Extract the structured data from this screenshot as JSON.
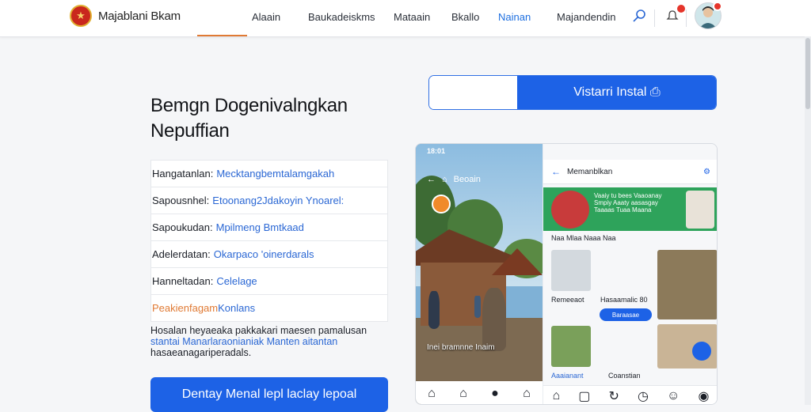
{
  "brand": {
    "name": "Majablani Bkam"
  },
  "nav": {
    "items": [
      "Alaain",
      "Baukadeiskms",
      "Mataain",
      "Bkallo",
      "Nainan",
      "Majandendin"
    ],
    "active_index": 4
  },
  "headline": [
    "Bemgn Dogenivalngkan",
    "Nepuffian"
  ],
  "install": {
    "button_label": "Vistarri Instal ⎙"
  },
  "info_rows": [
    {
      "key": "Hangatanlan:",
      "value": "Mecktangbemtalamgakah"
    },
    {
      "key": "Sapousnhel:",
      "value": "Etoonang2Jdakoyin Ynoarel:"
    },
    {
      "key": "Sapoukudan:",
      "value": "Mpilmeng Bmtkaad"
    },
    {
      "key": "Adelerdatan:",
      "value": "Okarpaco 'oinerdarals"
    },
    {
      "key": "Hanneltadan:",
      "value": "Celelage"
    },
    {
      "key": "Peakienfagam",
      "value": "Konlans",
      "accent": true
    }
  ],
  "description": {
    "lines": [
      "Hosalan heyaeaka pakkakari maesen pamalusan",
      "stantai Manarlaraonianiak Manten aitantan",
      "hasaeanagariperadals."
    ]
  },
  "cta": {
    "label": "Dentay Menal lepl laclay lepoal"
  },
  "left_screen": {
    "status_time": "18:01",
    "search_label": "Beoain",
    "caption": "Inei bramnne Inaim"
  },
  "right_screen": {
    "title": "Memanblkan",
    "banner_text": "Vaaiy tu bees Vaaoanay Smpiy Aaaty aasasgay Taaaas Tuaa Maana",
    "tabs": "Naa  Mlaa  Naaa  Naa",
    "card_label_1": "Remeeaot",
    "card_label_2": "Hasaamalic 80",
    "pill_label": "Baraasae",
    "bottom_label_1": "Aaaianant",
    "bottom_label_2": "Coanstian"
  },
  "colors": {
    "accent_blue": "#1d62e6",
    "accent_orange": "#e07a34",
    "link_blue": "#2a67d4"
  }
}
